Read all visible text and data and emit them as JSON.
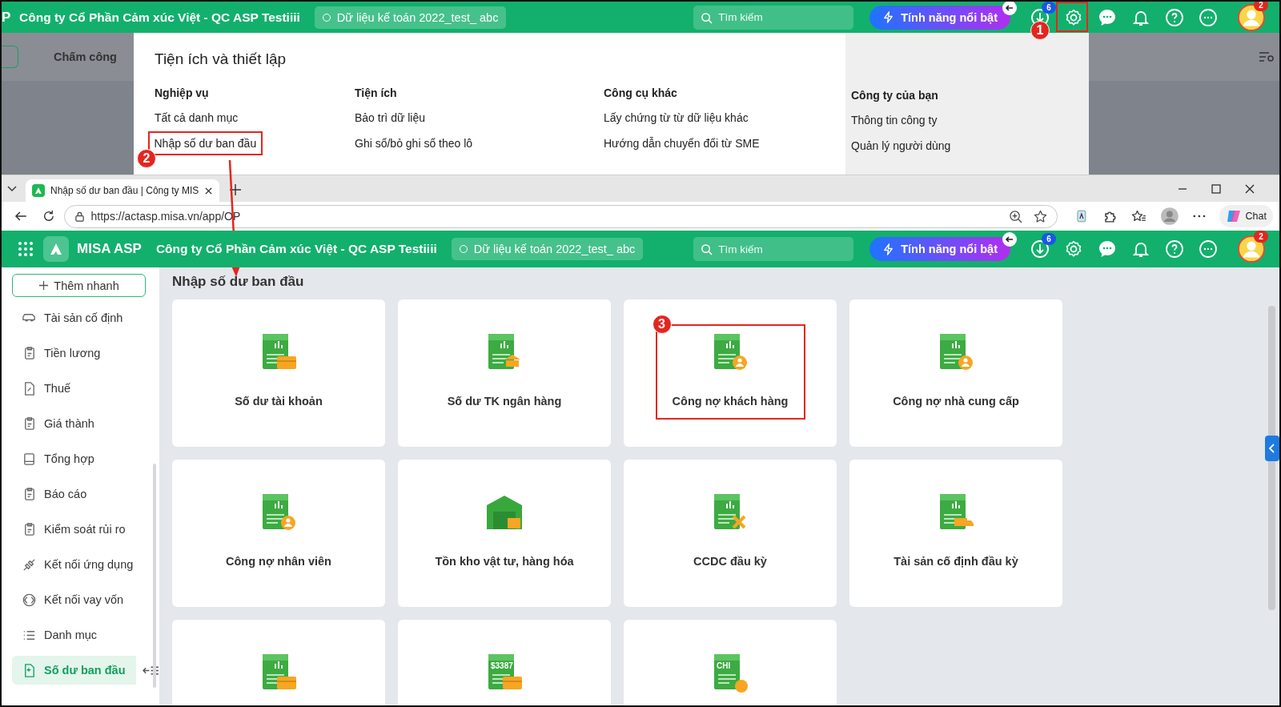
{
  "back_screen": {
    "header": {
      "logo_fragment": "P",
      "company": "Công ty Cổ Phần Cảm xúc Việt - QC ASP Testiiii",
      "dataset": "Dữ liệu kế toán 2022_test_ abc",
      "search": {
        "placeholder": "Tìm kiếm"
      },
      "feature_button": "Tính năng nổi bật",
      "download_badge": "6",
      "avatar_badge": "2",
      "settings_marker": "1"
    },
    "tab": "Chấm công",
    "settings_menu": {
      "title": "Tiện ích và thiết lập",
      "columns": [
        {
          "heading": "Nghiệp vụ",
          "shaded": false,
          "items": [
            {
              "label": "Tất cả danh mục"
            },
            {
              "label": "Nhập số dư ban đầu",
              "marker": "2"
            }
          ]
        },
        {
          "heading": "Tiện ích",
          "shaded": false,
          "items": [
            {
              "label": "Bảo trì dữ liệu"
            },
            {
              "label": "Ghi sổ/bỏ ghi sổ theo lô"
            }
          ]
        },
        {
          "heading": "Công cụ khác",
          "shaded": false,
          "items": [
            {
              "label": "Lấy chứng từ từ dữ liệu khác"
            },
            {
              "label": "Hướng dẫn chuyển đổi từ SME"
            }
          ]
        },
        {
          "heading": "Công ty của bạn",
          "shaded": true,
          "items": [
            {
              "label": "Thông tin công ty"
            },
            {
              "label": "Quản lý người dùng"
            }
          ]
        }
      ]
    }
  },
  "browser": {
    "tab_title": "Nhập số dư ban đầu | Công ty MIS",
    "url": "https://actasp.misa.vn/app/OP",
    "chat": "Chat"
  },
  "app": {
    "header": {
      "logo": "MISA ASP",
      "company": "Công ty Cổ Phần Cảm xúc Việt - QC ASP Testiiii",
      "dataset": "Dữ liệu kế toán 2022_test_ abc",
      "search": {
        "placeholder": "Tìm kiếm"
      },
      "feature_button": "Tính năng nổi bật",
      "download_badge": "6",
      "avatar_badge": "2"
    },
    "quick_add": "Thêm nhanh",
    "sidebar": {
      "items": [
        {
          "label": "Tài sản cố định",
          "selected": false
        },
        {
          "label": "Tiền lương",
          "selected": false
        },
        {
          "label": "Thuế",
          "selected": false
        },
        {
          "label": "Giá thành",
          "selected": false
        },
        {
          "label": "Tổng hợp",
          "selected": false
        },
        {
          "label": "Báo cáo",
          "selected": false
        },
        {
          "label": "Kiểm soát rủi ro",
          "selected": false
        },
        {
          "label": "Kết nối ứng dụng",
          "selected": false
        },
        {
          "label": "Kết nối vay vốn",
          "selected": false
        },
        {
          "label": "Danh mục",
          "selected": false
        },
        {
          "label": "Số dư ban đầu",
          "selected": true
        }
      ]
    },
    "page_title": "Nhập số dư ban đầu",
    "cards": [
      {
        "kind": "card",
        "label": "Số dư tài khoản"
      },
      {
        "kind": "bank",
        "label": "Số dư TK ngân hàng"
      },
      {
        "kind": "person",
        "label": "Công nợ khách hàng",
        "marker": "3"
      },
      {
        "kind": "person",
        "label": "Công nợ nhà cung cấp"
      },
      {
        "kind": "person",
        "label": "Công nợ nhân viên"
      },
      {
        "kind": "box",
        "label": "Tồn kho vật tư, hàng hóa"
      },
      {
        "kind": "tools",
        "label": "CCDC đầu kỳ"
      },
      {
        "kind": "truck",
        "label": "Tài sản cố định đầu kỳ"
      },
      {
        "kind": "card"
      },
      {
        "kind": "card",
        "icon_text": "$3387"
      },
      {
        "kind": "coin",
        "icon_text": "CHI"
      }
    ]
  }
}
